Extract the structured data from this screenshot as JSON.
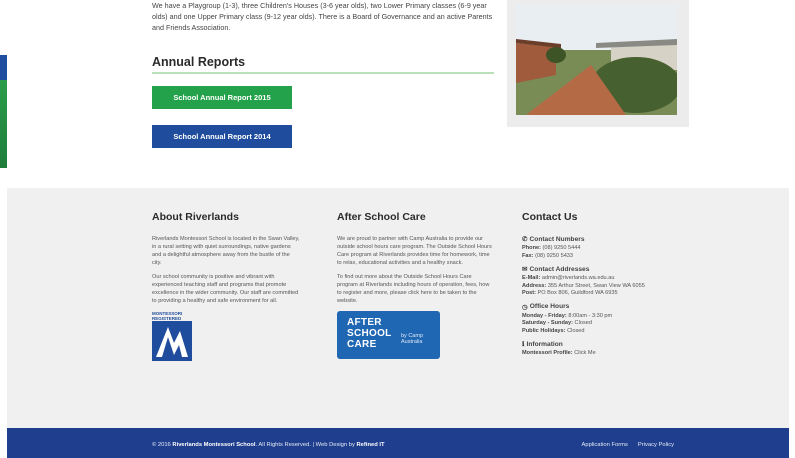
{
  "intro": {
    "text": "We have a Playgroup (1-3), three Children's Houses (3-6 year olds), two Lower Primary classes (6-9 year olds) and one Upper Primary class (9-12 year olds). There is a Board of Governance and an active Parents and Friends Association."
  },
  "annual_reports": {
    "title": "Annual Reports",
    "buttons": [
      {
        "label": "School Annual Report 2015"
      },
      {
        "label": "School Annual Report 2014"
      }
    ]
  },
  "colors": {
    "green": "#24a24b",
    "blue": "#1f4c9c",
    "footer_bg": "#f0f0f0",
    "bottom_bar": "#1f3f8e"
  },
  "footer": {
    "about": {
      "title": "About Riverlands",
      "p1": "Riverlands Montessori School is located in the Swan Valley, in a rural setting with quiet surroundings, native gardens and a delightful atmosphere away from the bustle of the city.",
      "p2": "Our school community is positive and vibrant with experienced teaching staff and programs that promote excellence in the wider community. Our staff are committed to providing a healthy and safe environment for all.",
      "logo_label": "MONTESSORI REGISTERED"
    },
    "after_school": {
      "title": "After School Care",
      "p1": "We are proud to partner with Camp Australia to provide our outside school hours care program. The Outside School Hours Care program at Riverlands provides time for homework, time to relax, educational activities and a healthy snack.",
      "p2": "To find out more about the Outside School Hours Care program at Riverlands including hours of operation, fees, how to register and more, please click here to be taken to the website.",
      "logo_line1": "AFTER",
      "logo_line2": "SCHOOL",
      "logo_line3": "CARE",
      "logo_by": "by Camp Australia"
    },
    "contact": {
      "title": "Contact Us",
      "numbers_head": "Contact Numbers",
      "phone_label": "Phone:",
      "phone": "(08) 9250 5444",
      "fax_label": "Fax:",
      "fax": "(08) 9250 5433",
      "addresses_head": "Contact Addresses",
      "email_label": "E-Mail:",
      "email": "admin@riverlands.wa.edu.au",
      "address_label": "Address:",
      "address": "355 Arthur Street, Swan View WA 6055",
      "post_label": "Post:",
      "post": "PO Box 806, Guildford WA 6935",
      "hours_head": "Office Hours",
      "hours1_label": "Monday - Friday:",
      "hours1": "8:00am - 3:30 pm",
      "hours2_label": "Saturday - Sunday:",
      "hours2": "Closed",
      "hours3_label": "Public Holidays:",
      "hours3": "Closed",
      "info_head": "Information",
      "info_label": "Montessori Profile:",
      "info": "Click Me"
    }
  },
  "bottom": {
    "copy_prefix": "© 2016",
    "school": "Riverlands Montessori School",
    "rights": ". All Rights Reserved. | Web Design by",
    "designer": "Refined IT",
    "link1": "Application Forms",
    "link2": "Privacy Policy"
  }
}
